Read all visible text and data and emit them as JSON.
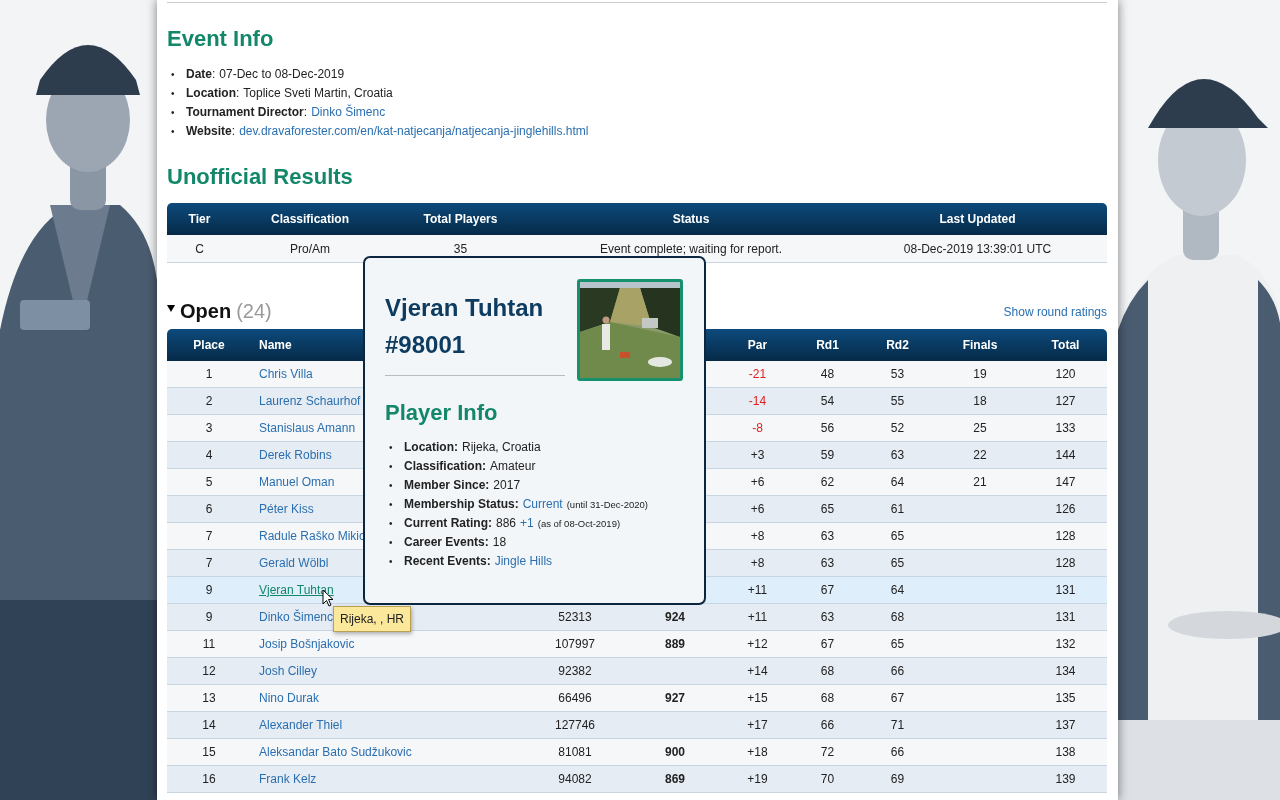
{
  "event_info": {
    "title": "Event Info",
    "items": [
      {
        "marker": "•",
        "label": "**Date**:",
        "value": "07-Dec to 08-Dec-2019"
      },
      {
        "marker": "•",
        "label": "**Location**:",
        "value": "Toplice Sveti Martin, Croatia"
      },
      {
        "marker": "•",
        "label": "**Tournament Director**:",
        "link": "Dinko Šimenc"
      },
      {
        "marker": "•",
        "label": "**Website**:",
        "link": "dev.dravaforester.com/en/kat-natjecanja/natjecanja-jinglehills.html"
      }
    ]
  },
  "results": {
    "title": "Unofficial Results",
    "columns": [
      "Tier",
      "Classification",
      "Total Players",
      "Status",
      "Last Updated"
    ],
    "rows": [
      [
        "C",
        "Pro/Am",
        "35",
        "Event complete; waiting for report.",
        "08-Dec-2019 13:39:01 UTC"
      ]
    ]
  },
  "division": {
    "name": "Open",
    "count": "(24)",
    "expanded": true,
    "link": "Show round ratings",
    "columns": [
      "Place",
      "Name",
      "Par",
      "Rd1",
      "Rd2",
      "Finals",
      "Total"
    ],
    "rows": [
      {
        "place": "1",
        "name": "Chris Villa",
        "par": "-21",
        "under_par": true,
        "rd1": "48",
        "rd2": "53",
        "finals": "19",
        "total": "120",
        "selected": false
      },
      {
        "place": "2",
        "name": "Laurenz Schaurhof",
        "par": "-14",
        "under_par": true,
        "rd1": "54",
        "rd2": "55",
        "finals": "18",
        "total": "127",
        "selected": false
      },
      {
        "place": "3",
        "name": "Stanislaus Amann",
        "par": "-8",
        "under_par": true,
        "rd1": "56",
        "rd2": "52",
        "finals": "25",
        "total": "133",
        "selected": false
      },
      {
        "place": "4",
        "name": "Derek Robins",
        "par": "+3",
        "under_par": false,
        "rd1": "59",
        "rd2": "63",
        "finals": "22",
        "total": "144",
        "selected": false
      },
      {
        "place": "5",
        "name": "Manuel Oman",
        "par": "+6",
        "under_par": false,
        "rd1": "62",
        "rd2": "64",
        "finals": "21",
        "total": "147",
        "selected": false
      },
      {
        "place": "6",
        "name": "Péter Kiss",
        "par": "+6",
        "under_par": false,
        "rd1": "65",
        "rd2": "61",
        "total": "126",
        "selected": false
      },
      {
        "place": "7",
        "name": "Radule Raško Mikic",
        "par": "+8",
        "under_par": false,
        "rd1": "63",
        "rd2": "65",
        "total": "128",
        "selected": false
      },
      {
        "place": "7",
        "name": "Gerald Wölbl",
        "par": "+8",
        "under_par": false,
        "rd1": "63",
        "rd2": "65",
        "total": "128",
        "selected": false
      },
      {
        "place": "9",
        "name": "Vjeran Tuhtan",
        "par": "+11",
        "under_par": false,
        "rd1": "67",
        "rd2": "64",
        "total": "131",
        "selected": true
      },
      {
        "place": "9",
        "name": "Dinko Šimenc",
        "pdga": "52313",
        "rating": "924",
        "par": "+11",
        "under_par": false,
        "rd1": "63",
        "rd2": "68",
        "total": "131",
        "selected": false
      },
      {
        "place": "11",
        "name": "Josip Bošnjakovic",
        "pdga": "107997",
        "rating": "889",
        "par": "+12",
        "under_par": false,
        "rd1": "67",
        "rd2": "65",
        "total": "132",
        "selected": false
      },
      {
        "place": "12",
        "name": "Josh Cilley",
        "pdga": "92382",
        "par": "+14",
        "under_par": false,
        "rd1": "68",
        "rd2": "66",
        "total": "134",
        "selected": false
      },
      {
        "place": "13",
        "name": "Nino Durak",
        "pdga": "66496",
        "rating": "927",
        "par": "+15",
        "under_par": false,
        "rd1": "68",
        "rd2": "67",
        "total": "135",
        "selected": false
      },
      {
        "place": "14",
        "name": "Alexander Thiel",
        "pdga": "127746",
        "par": "+17",
        "under_par": false,
        "rd1": "66",
        "rd2": "71",
        "total": "137",
        "selected": false
      },
      {
        "place": "15",
        "name": "Aleksandar Bato Sudžukovic",
        "pdga": "81081",
        "rating": "900",
        "par": "+18",
        "under_par": false,
        "rd1": "72",
        "rd2": "66",
        "total": "138",
        "selected": false
      },
      {
        "place": "16",
        "name": "Frank Kelz",
        "pdga": "94082",
        "rating": "869",
        "par": "+19",
        "under_par": false,
        "rd1": "70",
        "rd2": "69",
        "total": "139",
        "selected": false
      }
    ]
  },
  "player_popup": {
    "name": "Vjeran Tuhtan",
    "number": "#98001",
    "section": "Player Info",
    "items": [
      {
        "marker": "•",
        "label": "Location:",
        "value": "Rijeka, Croatia"
      },
      {
        "marker": "•",
        "label": "Classification:",
        "value": "Amateur"
      },
      {
        "marker": "•",
        "label": "Member Since:",
        "value": "2017"
      },
      {
        "marker": "•",
        "label": "Membership Status:",
        "link": "Current",
        "note": "(until 31-Dec-2020)"
      },
      {
        "marker": "•",
        "label": "Current Rating:",
        "value": "886",
        "link": "+1",
        "note": "(as of 08-Oct-2019)"
      },
      {
        "marker": "•",
        "label": "Career Events:",
        "value": "18"
      },
      {
        "marker": "•",
        "label": "Recent Events:",
        "link": "Jingle Hills"
      }
    ]
  },
  "tooltip": "Rijeka, , HR"
}
